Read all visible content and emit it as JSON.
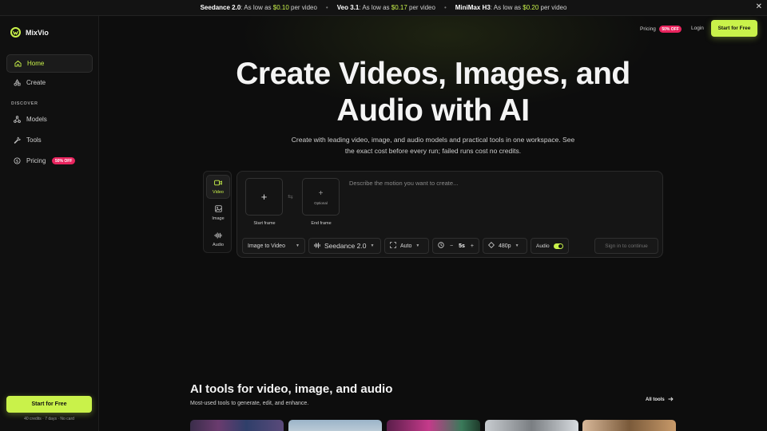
{
  "announcement": {
    "items": [
      {
        "name": "Seedance 2.0",
        "text": ": As low as ",
        "price": "$0.10",
        "unit": " per video"
      },
      {
        "name": "Veo 3.1",
        "text": ": As low as ",
        "price": "$0.17",
        "unit": " per video"
      },
      {
        "name": "MiniMax H3",
        "text": ": As low as ",
        "price": "$0.20",
        "unit": " per video"
      }
    ],
    "separator": "•",
    "close": "✕"
  },
  "brand": {
    "name": "MixVio",
    "accent": "#c9f24a"
  },
  "sidebar": {
    "home": "Home",
    "create": "Create",
    "discover_heading": "DISCOVER",
    "models": "Models",
    "tools": "Tools",
    "pricing": "Pricing",
    "pricing_badge": "50% OFF",
    "cta": "Start for Free",
    "cta_note": "40 credits · 7 days · No card"
  },
  "header": {
    "pricing": "Pricing",
    "pricing_badge": "50% OFF",
    "login": "Login",
    "cta": "Start for Free"
  },
  "hero": {
    "title_line1": "Create Videos, Images, and",
    "title_line2": "Audio with AI",
    "subtitle": "Create with leading video, image, and audio models and practical tools in one workspace. See the exact cost before every run; failed runs cost no credits."
  },
  "composer": {
    "modes": [
      {
        "label": "Video",
        "icon": "video-camera-icon",
        "active": true
      },
      {
        "label": "Image",
        "icon": "image-icon",
        "active": false
      },
      {
        "label": "Audio",
        "icon": "audio-wave-icon",
        "active": false
      }
    ],
    "start_frame_label": "Start frame",
    "end_frame_label": "End frame",
    "end_frame_optional": "Optional",
    "prompt_placeholder": "Describe the motion you want to create...",
    "mode_select": "Image to Video",
    "model_select": "Seedance 2.0",
    "aspect_select": "Auto",
    "duration_minus": "−",
    "duration_value": "5s",
    "duration_plus": "+",
    "resolution_select": "480p",
    "audio_label": "Audio",
    "audio_enabled": true,
    "submit_label": "Sign in to continue"
  },
  "tools_section": {
    "title": "AI tools for video, image, and audio",
    "subtitle": "Most-used tools to generate, edit, and enhance.",
    "all_tools": "All tools"
  }
}
